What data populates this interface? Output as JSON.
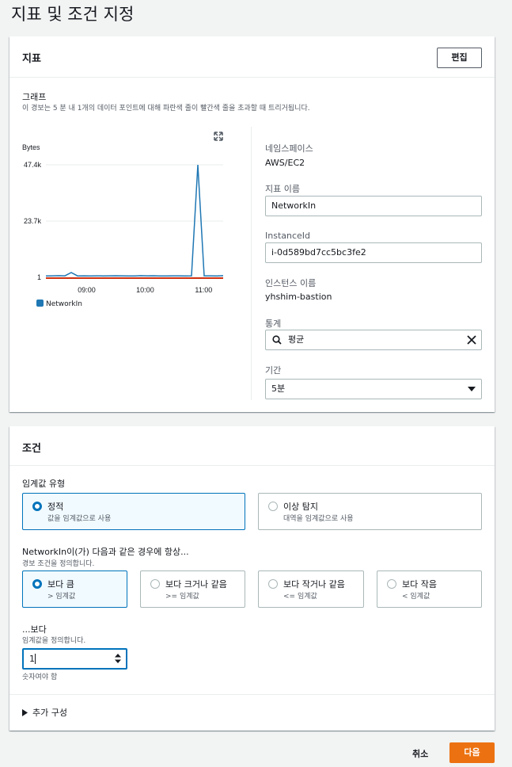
{
  "page_title": "지표 및 조건 지정",
  "metric_card": {
    "title": "지표",
    "edit_label": "편집",
    "graph_label": "그래프",
    "graph_desc": "이 경보는 5 분 내 1개의 데이터 포인트에 대해 파란색 줄이 빨간색 줄을 초과할 때 트리거됩니다.",
    "namespace_label": "네임스페이스",
    "namespace_value": "AWS/EC2",
    "metric_name_label": "지표 이름",
    "metric_name_value": "NetworkIn",
    "instance_id_label": "InstanceId",
    "instance_id_value": "i-0d589bd7cc5bc3fe2",
    "instance_name_label": "인스턴스 이름",
    "instance_name_value": "yhshim-bastion",
    "statistic_label": "통계",
    "statistic_value": "평균",
    "period_label": "기간",
    "period_value": "5분"
  },
  "chart_data": {
    "type": "line",
    "ylabel": "Bytes",
    "y_ticks": [
      "47.4k",
      "23.7k",
      "1"
    ],
    "ylim": [
      0,
      47400
    ],
    "x_ticks": [
      "09:00",
      "10:00",
      "11:00"
    ],
    "series": [
      {
        "name": "NetworkIn",
        "color": "#1f77b4",
        "values": [
          600,
          650,
          700,
          640,
          2000,
          600,
          620,
          580,
          640,
          600,
          650,
          680,
          620,
          600,
          590,
          700,
          640,
          660,
          600,
          580,
          620,
          640,
          600,
          650,
          47400,
          650,
          640,
          600,
          700
        ]
      }
    ],
    "threshold": {
      "value": 1,
      "color": "#d13212"
    },
    "legend": "bottom-left"
  },
  "condition_card": {
    "title": "조건",
    "threshold_type_label": "임계값 유형",
    "static_title": "정적",
    "static_desc": "값을 임계값으로 사용",
    "anomaly_title": "이상 탐지",
    "anomaly_desc": "대역을 임계값으로 사용",
    "whenever_label": "NetworkIn이(가) 다음과 같은 경우에 항상...",
    "whenever_desc": "경보 조건을 정의합니다.",
    "options": [
      {
        "title": "보다 큼",
        "desc": "> 임계값"
      },
      {
        "title": "보다 크거나 같음",
        "desc": ">= 임계값"
      },
      {
        "title": "보다 작거나 같음",
        "desc": "<= 임계값"
      },
      {
        "title": "보다 작음",
        "desc": "< 임계값"
      }
    ],
    "than_label": "...보다",
    "than_desc": "임계값을 정의합니다.",
    "threshold_value": "1",
    "must_be_number": "숫자여야 함",
    "additional_config": "추가 구성"
  },
  "footer": {
    "cancel_label": "취소",
    "next_label": "다음"
  }
}
